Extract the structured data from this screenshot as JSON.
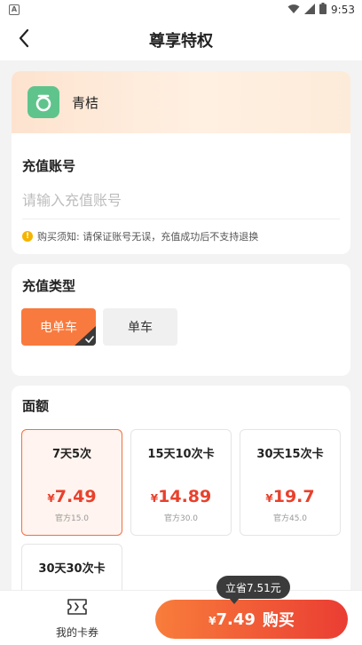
{
  "status_bar": {
    "time": "9:53",
    "left_icon": "A"
  },
  "nav": {
    "title": "尊享特权"
  },
  "brand": {
    "name": "青桔"
  },
  "account": {
    "label": "充值账号",
    "placeholder": "请输入充值账号",
    "value": "",
    "notice": "购买须知: 请保证账号无误，充值成功后不支持退换"
  },
  "recharge_type": {
    "title": "充值类型",
    "options": [
      {
        "label": "电单车",
        "selected": true
      },
      {
        "label": "单车",
        "selected": false
      }
    ]
  },
  "denominations": {
    "title": "面额",
    "currency": "¥",
    "items": [
      {
        "name": "7天5次",
        "price": "7.49",
        "official": "官方15.0",
        "selected": true
      },
      {
        "name": "15天10次卡",
        "price": "14.89",
        "official": "官方30.0",
        "selected": false
      },
      {
        "name": "30天15次卡",
        "price": "19.7",
        "official": "官方45.0",
        "selected": false
      },
      {
        "name": "30天30次卡",
        "price": "",
        "official": "",
        "selected": false
      }
    ]
  },
  "bottom_bar": {
    "my_cards_label": "我的卡券",
    "save_tip": "立省7.51元",
    "buy_price": "7.49",
    "buy_label": "购买"
  },
  "colors": {
    "accent": "#f97a3e",
    "price_red": "#e8412c",
    "brand_green": "#5fc48c"
  },
  "icons": [
    "back-arrow-icon",
    "qingju-logo-icon",
    "warning-icon",
    "check-icon",
    "ticket-icon",
    "wifi-icon",
    "signal-icon",
    "battery-icon"
  ]
}
